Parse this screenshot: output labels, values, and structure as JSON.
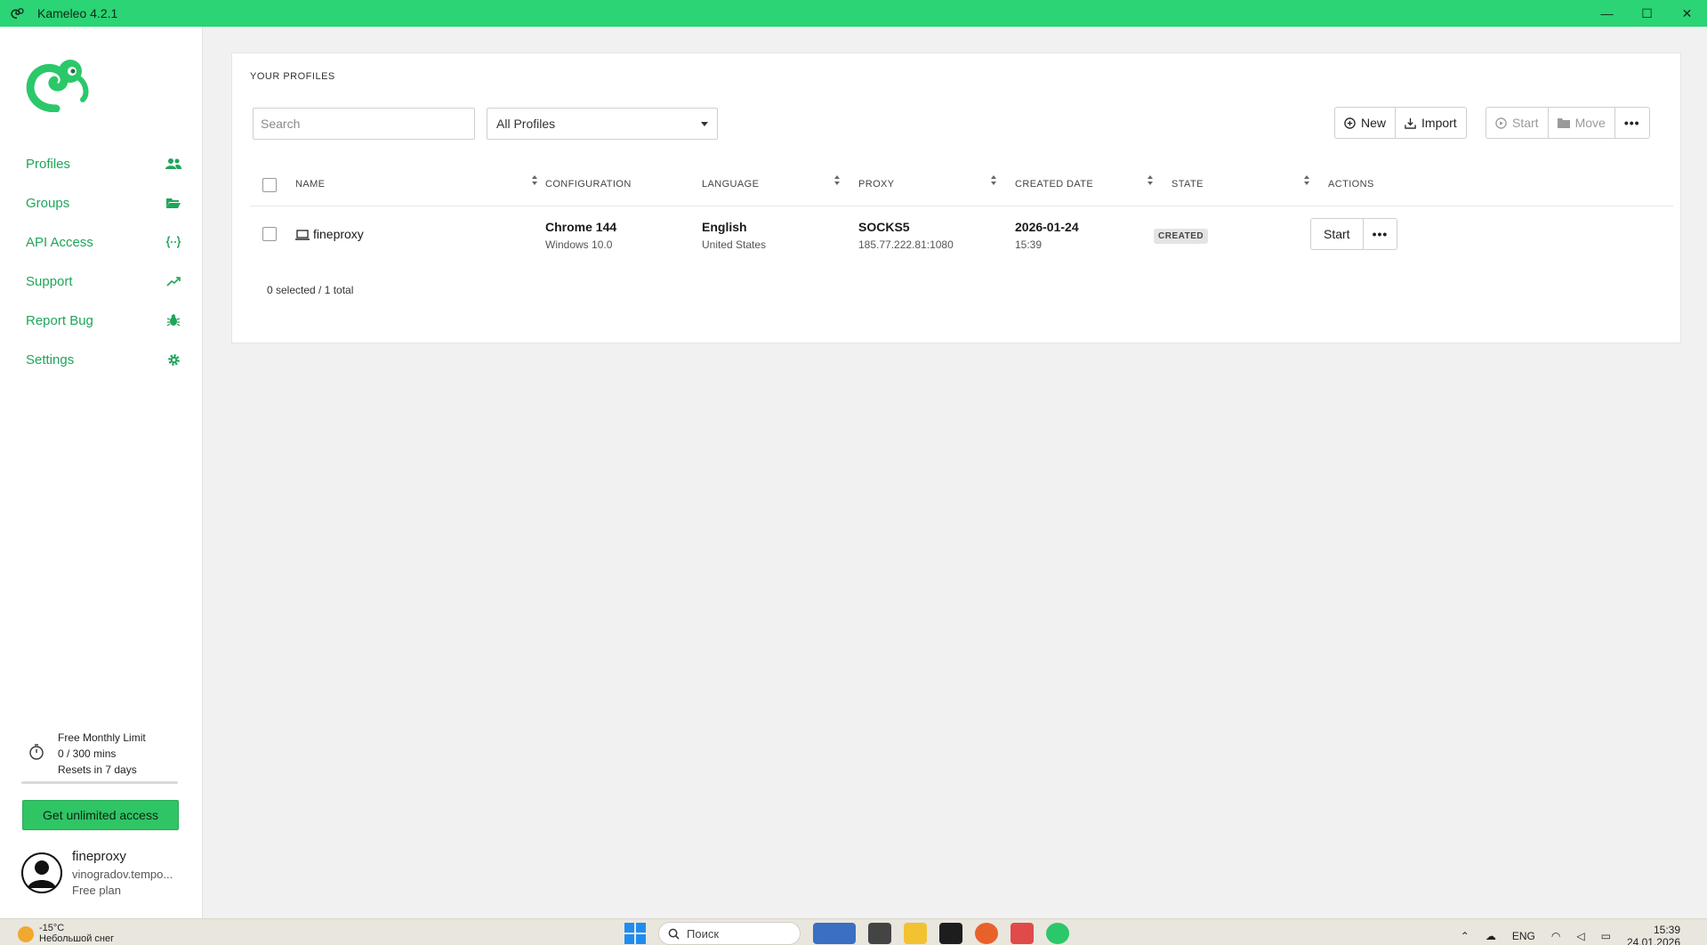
{
  "window": {
    "title": "Kameleo 4.2.1",
    "minimize": "—",
    "maximize": "☐",
    "close": "✕"
  },
  "colors": {
    "brand": "#2bd474",
    "nav_text": "#1fa55a",
    "cta": "#2fc565"
  },
  "sidebar": {
    "items": [
      {
        "label": "Profiles",
        "icon": "users-icon"
      },
      {
        "label": "Groups",
        "icon": "folder-open-icon"
      },
      {
        "label": "API Access",
        "icon": "code-braces-icon"
      },
      {
        "label": "Support",
        "icon": "trend-up-icon"
      },
      {
        "label": "Report Bug",
        "icon": "bug-icon"
      },
      {
        "label": "Settings",
        "icon": "gear-icon"
      }
    ],
    "limit": {
      "title": "Free Monthly Limit",
      "usage": "0 / 300 mins",
      "reset": "Resets in 7 days",
      "used_fraction": 0
    },
    "cta_label": "Get unlimited access",
    "user": {
      "name": "fineproxy",
      "email": "vinogradov.tempo...",
      "plan": "Free plan"
    }
  },
  "main": {
    "title": "YOUR PROFILES",
    "search_placeholder": "Search",
    "filter_value": "All Profiles",
    "toolbar": {
      "new_label": "New",
      "import_label": "Import",
      "start_label": "Start",
      "move_label": "Move",
      "more_label": "•••"
    },
    "columns": [
      "NAME",
      "CONFIGURATION",
      "LANGUAGE",
      "PROXY",
      "CREATED DATE",
      "STATE",
      "ACTIONS"
    ],
    "rows": [
      {
        "name": "fineproxy",
        "config": "Chrome 144",
        "os": "Windows 10.0",
        "language": "English",
        "region": "United States",
        "proxy_type": "SOCKS5",
        "proxy_addr": "185.77.222.81:1080",
        "date": "2026-01-24",
        "time": "15:39",
        "state": "CREATED",
        "action_label": "Start",
        "more_label": "•••"
      }
    ],
    "summary": "0 selected / 1 total"
  },
  "taskbar": {
    "temp": "-15°C",
    "weather": "Небольшой снег",
    "search_label": "Поиск",
    "lang": "ENG",
    "time": "15:39",
    "date": "24.01.2026"
  }
}
